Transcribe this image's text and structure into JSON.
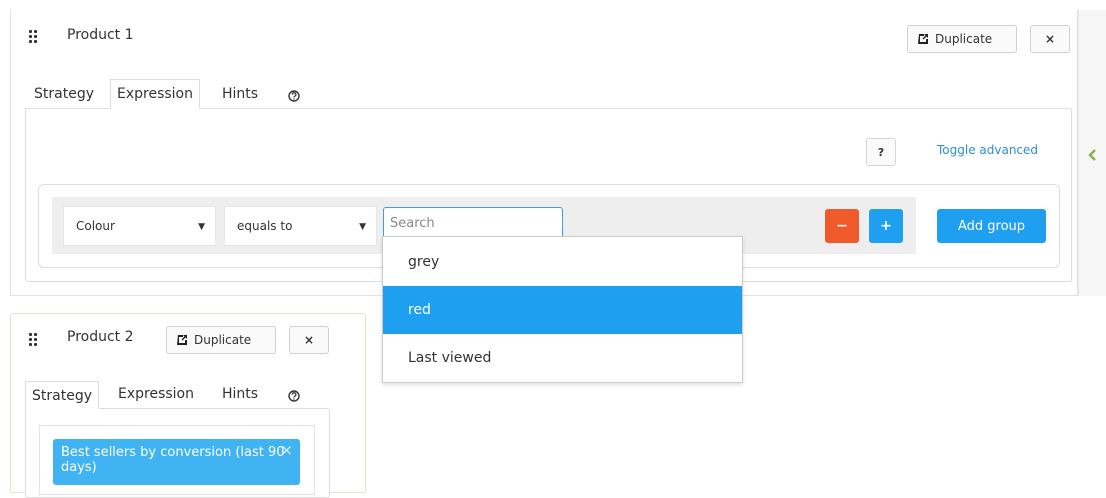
{
  "product1": {
    "title": "Product 1",
    "duplicate_label": "Duplicate",
    "close_label": "×",
    "tabs": [
      {
        "label": "Strategy",
        "active": false
      },
      {
        "label": "Expression",
        "active": true
      },
      {
        "label": "Hints",
        "active": false
      }
    ],
    "help_label": "?",
    "toggle_advanced": "Toggle advanced",
    "rule": {
      "field_value": "Colour",
      "operator_value": "equals to",
      "search_placeholder": "Search",
      "minus_label": "−",
      "plus_label": "+"
    },
    "add_group_label": "Add group"
  },
  "dropdown": {
    "options": [
      {
        "label": "grey",
        "highlighted": false
      },
      {
        "label": "red",
        "highlighted": true
      },
      {
        "label": "Last viewed",
        "highlighted": false
      }
    ]
  },
  "product2": {
    "title": "Product 2",
    "duplicate_label": "Duplicate",
    "close_label": "×",
    "tabs": [
      {
        "label": "Strategy",
        "active": true
      },
      {
        "label": "Expression",
        "active": false
      },
      {
        "label": "Hints",
        "active": false
      }
    ],
    "strategy_tag": "Best sellers by conversion (last 90 days)",
    "strategy_tag_remove": "×"
  },
  "icons": {
    "drag": "drag-handle-icon",
    "duplicate": "external-link-icon",
    "help": "question-circle-icon",
    "collapse": "chevron-left-icon",
    "caret": "caret-down-icon"
  },
  "colors": {
    "accent_blue": "#1f9ff0",
    "danger_orange": "#f05a2a",
    "link_blue": "#2a8fd6",
    "tag_blue": "#40b3f2",
    "collapse_green": "#8ab04a"
  }
}
